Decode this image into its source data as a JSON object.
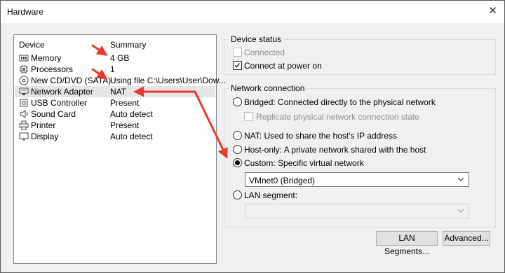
{
  "window": {
    "title": "Hardware",
    "close_glyph": "✕"
  },
  "device_list": {
    "col_device": "Device",
    "col_summary": "Summary",
    "items": [
      {
        "name": "Memory",
        "summary": "4 GB",
        "icon": "memory-icon"
      },
      {
        "name": "Processors",
        "summary": "1",
        "icon": "processor-icon"
      },
      {
        "name": "New CD/DVD (SATA)",
        "summary": "Using file C:\\Users\\User\\Dow...",
        "icon": "cd-dvd-icon"
      },
      {
        "name": "Network Adapter",
        "summary": "NAT",
        "icon": "network-adapter-icon",
        "selected": true
      },
      {
        "name": "USB Controller",
        "summary": "Present",
        "icon": "usb-controller-icon"
      },
      {
        "name": "Sound Card",
        "summary": "Auto detect",
        "icon": "sound-card-icon"
      },
      {
        "name": "Printer",
        "summary": "Present",
        "icon": "printer-icon"
      },
      {
        "name": "Display",
        "summary": "Auto detect",
        "icon": "display-icon"
      }
    ]
  },
  "device_status": {
    "legend": "Device status",
    "connected": {
      "label": "Connected",
      "checked": false,
      "enabled": false
    },
    "connect_at_power_on": {
      "label": "Connect at power on",
      "checked": true
    }
  },
  "network_connection": {
    "legend": "Network connection",
    "bridged": {
      "label": "Bridged: Connected directly to the physical network",
      "selected": false
    },
    "replicate": {
      "label": "Replicate physical network connection state",
      "checked": false,
      "enabled": false
    },
    "nat": {
      "label": "NAT: Used to share the host's IP address",
      "selected": false
    },
    "host_only": {
      "label": "Host-only: A private network shared with the host",
      "selected": false
    },
    "custom": {
      "label": "Custom: Specific virtual network",
      "selected": true
    },
    "vmnet_select": {
      "value": "VMnet0 (Bridged)"
    },
    "lan_segment": {
      "label": "LAN segment:",
      "selected": false
    },
    "lan_segment_select": {
      "value": ""
    }
  },
  "buttons": {
    "lan_segments": "LAN Segments...",
    "advanced": "Advanced..."
  },
  "colors": {
    "annotation_arrow": "#e8392d",
    "selection_bg": "#e5e5e5"
  }
}
